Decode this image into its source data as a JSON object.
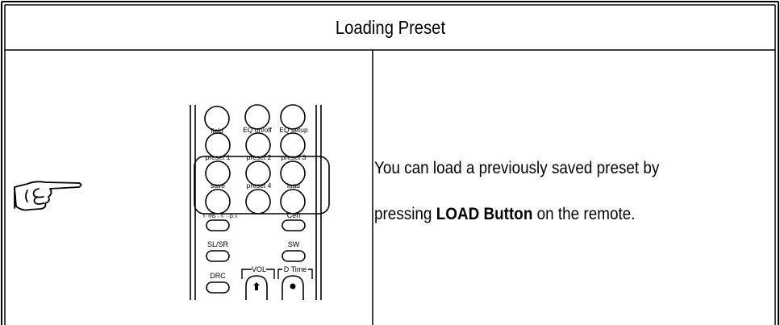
{
  "table": {
    "title": "Loading Preset",
    "description": {
      "line1": "You can load a previously saved preset by",
      "line2_prefix": "pressing ",
      "line2_bold": "LOAD Button",
      "line2_suffix": " on the remote."
    }
  },
  "remote": {
    "buttons": {
      "field": "field",
      "eq_onoff": "EQ on/off",
      "eq_setup": "EQ setup",
      "preset1": "preset 1",
      "preset2": "preset 2",
      "preset3": "preset 3",
      "save": "save",
      "preset4": "preset 4",
      "load": "load",
      "cen": "Cen",
      "slsr": "SL/SR",
      "sw": "SW",
      "drc": "DRC",
      "vol": "VOL",
      "dtime": "D Time"
    },
    "small_labels": "f· ms  ··f·  ··p.√"
  },
  "icons": {
    "pointing_hand": "pointing-hand-icon"
  }
}
